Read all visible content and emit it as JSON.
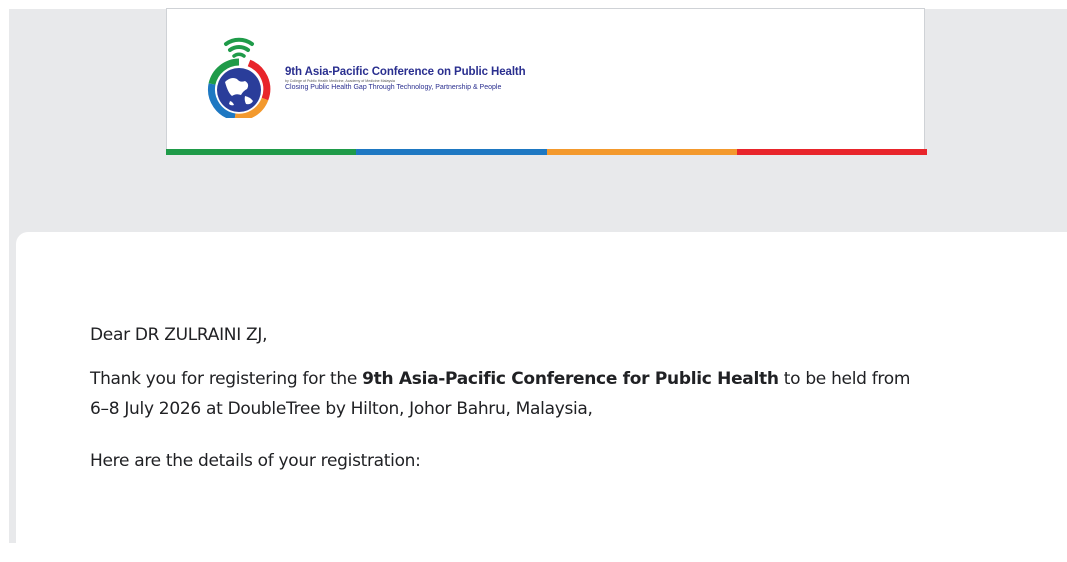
{
  "banner": {
    "title": "9th Asia-Pacific Conference on Public Health",
    "subtitle": "by College of Public Health Medicine, Academy of Medicine Malaysia",
    "tagline": "Closing Public Health Gap Through Technology, Partnership & People",
    "stripe_colors": [
      "#1f9b49",
      "#1e78c2",
      "#f3992d",
      "#e8252b"
    ]
  },
  "email": {
    "greeting": "Dear DR ZULRAINI ZJ,",
    "intro_before": "Thank you for registering for the ",
    "conference_name": "9th Asia-Pacific Conference for Public Health",
    "intro_after": " to be held from 6–8 July 2026 at DoubleTree by Hilton, Johor Bahru, Malaysia,",
    "details_line": "Here are the details of your registration:"
  },
  "icons": {
    "logo": "conference-globe-wifi-logo"
  }
}
